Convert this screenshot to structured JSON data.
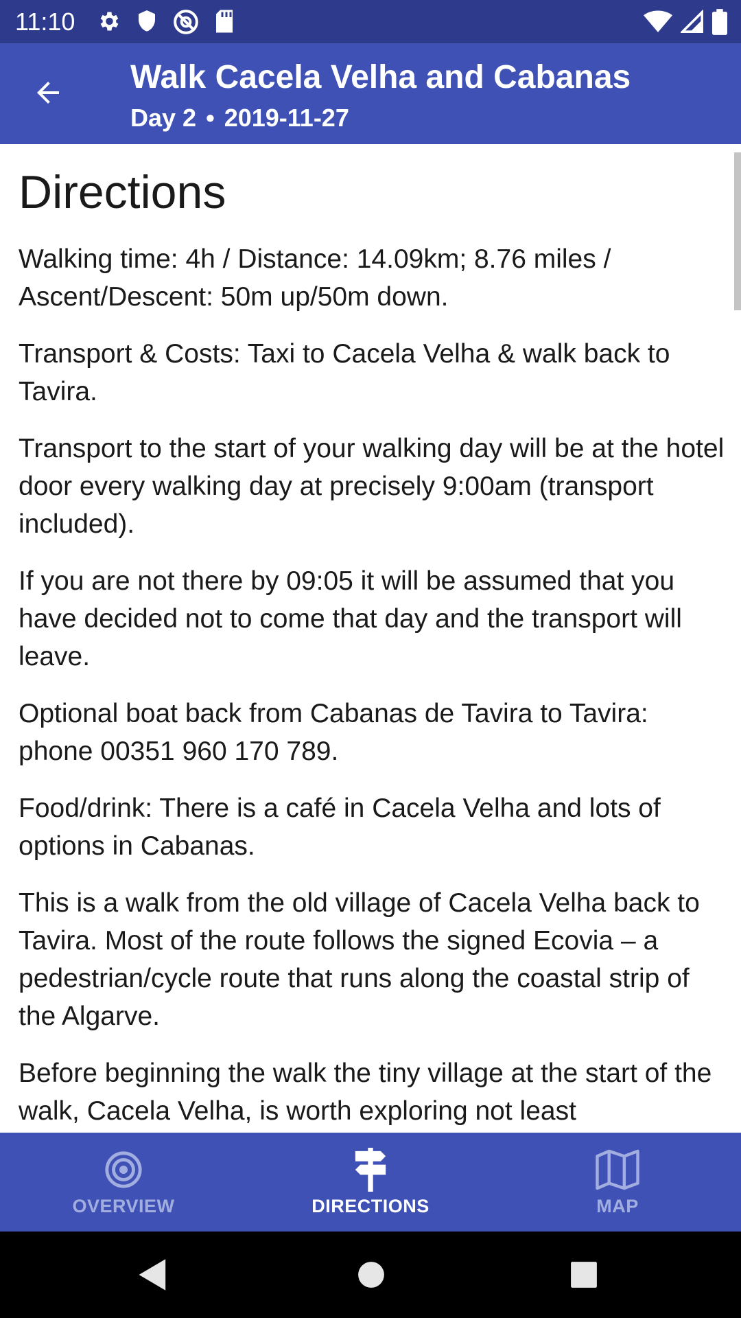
{
  "status_bar": {
    "time": "11:10",
    "left_icons": [
      "settings-icon",
      "shield-icon",
      "do-not-disturb-icon",
      "sd-card-icon"
    ],
    "right_icons": [
      "wifi-icon",
      "signal-icon",
      "battery-icon"
    ]
  },
  "app_bar": {
    "title": "Walk Cacela Velha and Cabanas",
    "day": "Day 2",
    "separator": "•",
    "date": "2019-11-27",
    "back_icon": "arrow-back-icon"
  },
  "content": {
    "heading": "Directions",
    "paragraphs": [
      "Walking time: 4h / Distance: 14.09km; 8.76 miles / Ascent/Descent: 50m up/50m down.",
      "Transport & Costs: Taxi to Cacela Velha & walk back to Tavira.",
      "Transport to the start of your walking day will be at the hotel door every walking day at precisely 9:00am (transport included).",
      "If you are not there by 09:05 it will be assumed that you have decided not to come that day and the transport will leave.",
      "Optional boat back from Cabanas de Tavira to Tavira: phone 00351 960 170 789.",
      "Food/drink: There is a café in Cacela Velha and lots of options in Cabanas.",
      "This is a walk from the old village of Cacela Velha back to Tavira. Most of the route follows the signed Ecovia – a pedestrian/cycle route that runs along the coastal strip of the Algarve.",
      "Before beginning the walk the tiny village at the start of the walk, Cacela Velha, is worth exploring not least"
    ]
  },
  "bottom_nav": {
    "items": [
      {
        "label": "OVERVIEW",
        "icon": "target-icon",
        "active": false
      },
      {
        "label": "DIRECTIONS",
        "icon": "signpost-icon",
        "active": true
      },
      {
        "label": "MAP",
        "icon": "map-icon",
        "active": false
      }
    ]
  },
  "colors": {
    "status_bar": "#2e3b8c",
    "primary": "#3f51b5",
    "inactive_nav": "#a3aee0",
    "text": "#1a1a1a"
  }
}
